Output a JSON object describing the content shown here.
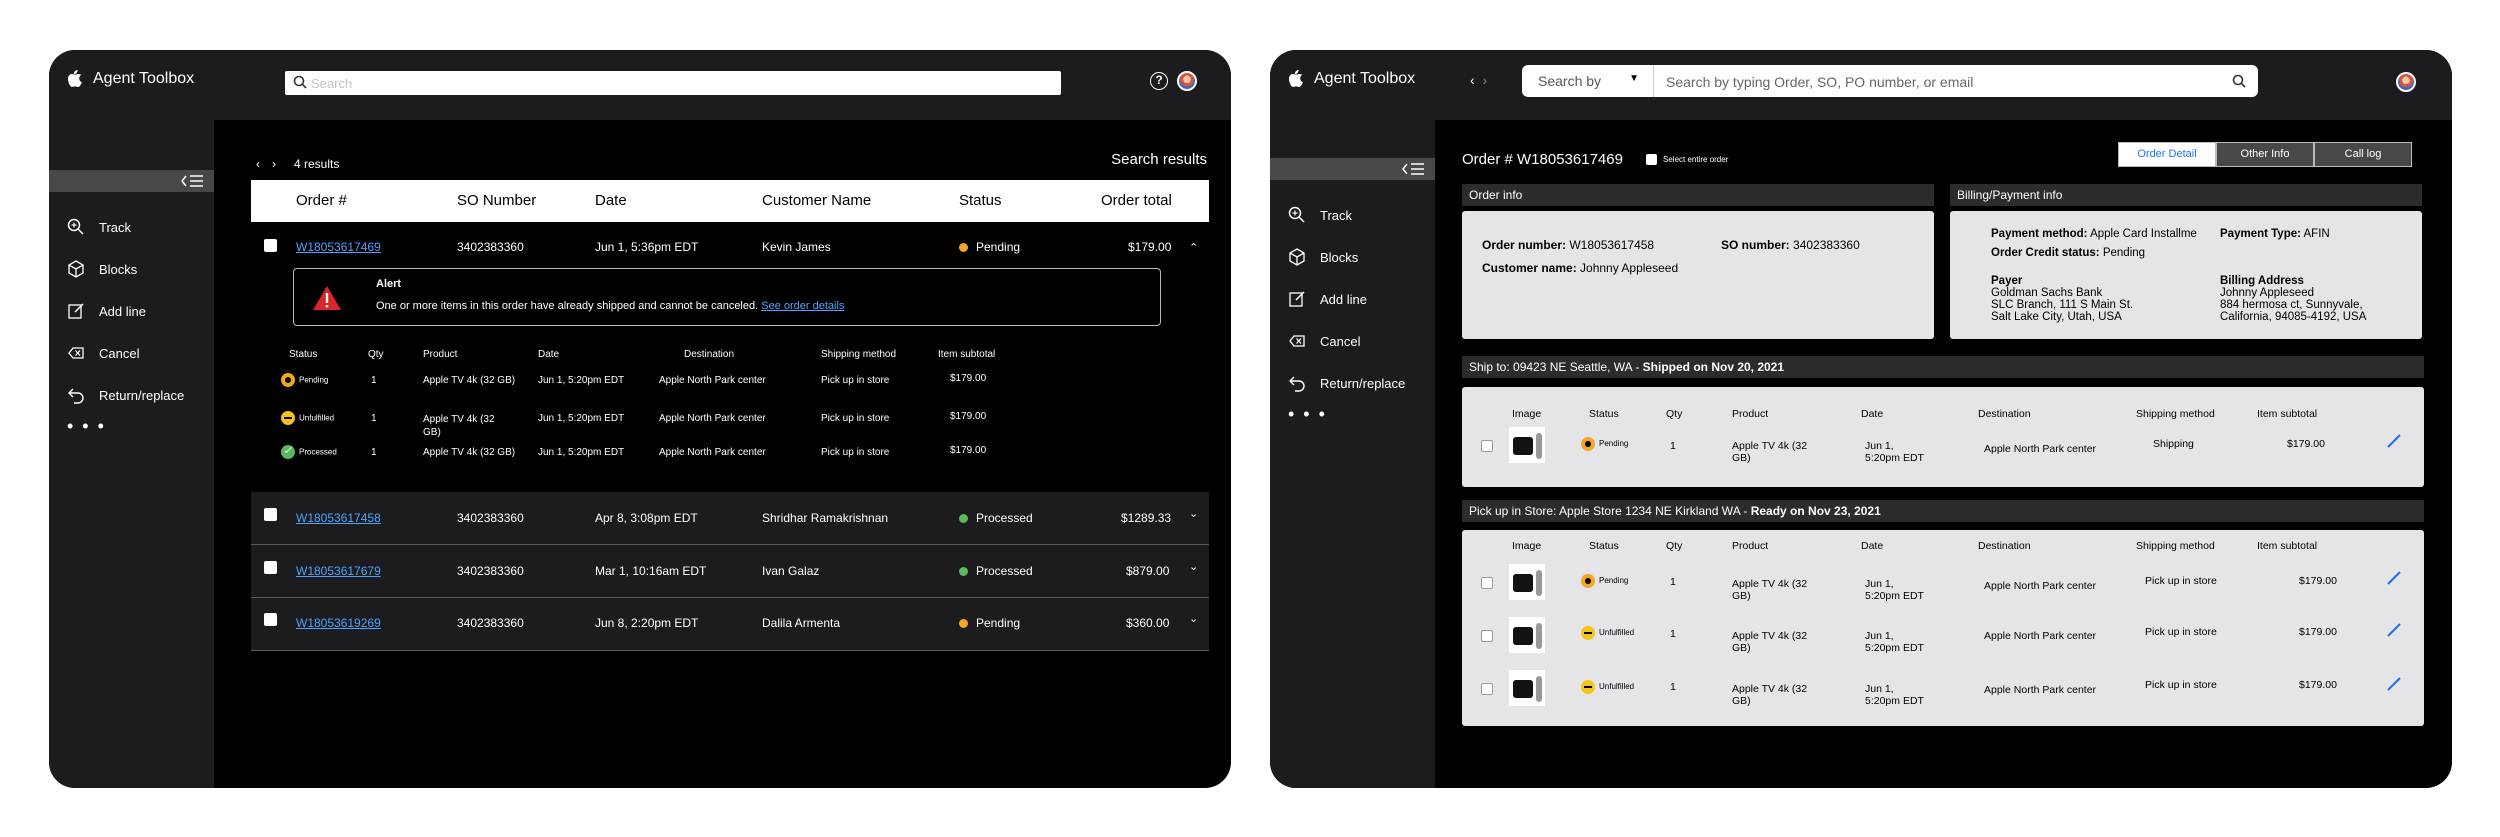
{
  "app": {
    "title": "Agent Toolbox"
  },
  "nav": {
    "items": [
      {
        "label": "Track",
        "icon": "search-magnify-icon"
      },
      {
        "label": "Blocks",
        "icon": "cube-icon"
      },
      {
        "label": "Add line",
        "icon": "edit-icon"
      },
      {
        "label": "Cancel",
        "icon": "cancel-icon"
      },
      {
        "label": "Return/replace",
        "icon": "return-icon"
      }
    ],
    "more": "• • •"
  },
  "screen1": {
    "search_placeholder": "Search",
    "help": "?",
    "result_count": "4 results",
    "results_title": "Search results",
    "columns": [
      "Order #",
      "SO Number",
      "Date",
      "Customer Name",
      "Status",
      "Order total"
    ],
    "orders": [
      {
        "order": "W18053617469",
        "so": "3402383360",
        "date": "Jun 1, 5:36pm EDT",
        "customer": "Kevin James",
        "status": "Pending",
        "total": "$179.00"
      },
      {
        "order": "W18053617458",
        "so": "3402383360",
        "date": "Apr 8, 3:08pm EDT",
        "customer": "Shridhar Ramakrishnan",
        "status": "Processed",
        "total": "$1289.33"
      },
      {
        "order": "W18053617679",
        "so": "3402383360",
        "date": "Mar 1, 10:16am EDT",
        "customer": "Ivan Galaz",
        "status": "Processed",
        "total": "$879.00"
      },
      {
        "order": "W18053619269",
        "so": "3402383360",
        "date": "Jun 8, 2:20pm EDT",
        "customer": "Dalila Armenta",
        "status": "Pending",
        "total": "$360.00"
      }
    ],
    "alert": {
      "title": "Alert",
      "message": "One or more items in this order have already shipped and cannot be canceled.",
      "link": "See order details"
    },
    "line_columns": [
      "Status",
      "Qty",
      "Product",
      "Date",
      "Destination",
      "Shipping method",
      "Item subtotal"
    ],
    "lines": [
      {
        "status": "Pending",
        "qty": "1",
        "product": "Apple TV 4k (32 GB)",
        "date": "Jun 1, 5:20pm EDT",
        "destination": "Apple North Park center",
        "shipping": "Pick up in store",
        "subtotal": "$179.00"
      },
      {
        "status": "Unfulfilled",
        "qty": "1",
        "product": "Apple TV 4k (32 GB)",
        "date": "Jun 1, 5:20pm EDT",
        "destination": "Apple North Park center",
        "shipping": "Pick up in store",
        "subtotal": "$179.00"
      },
      {
        "status": "Processed",
        "qty": "1",
        "product": "Apple TV 4k (32 GB)",
        "date": "Jun 1, 5:20pm EDT",
        "destination": "Apple North Park center",
        "shipping": "Pick up in store",
        "subtotal": "$179.00"
      }
    ]
  },
  "screen2": {
    "search_by": "Search by",
    "search_placeholder": "Search by typing Order, SO, PO number, or email",
    "order_heading": "Order # W18053617469",
    "select_entire": "Select entire order",
    "tabs": [
      "Order Detail",
      "Other Info",
      "Call log"
    ],
    "order_info": {
      "header": "Order info",
      "order_number_label": "Order number:",
      "order_number": "W18053617458",
      "so_label": "SO number:",
      "so": "3402383360",
      "customer_label": "Customer name:",
      "customer": "Johnny Appleseed"
    },
    "billing": {
      "header": "Billing/Payment info",
      "payment_method_label": "Payment method:",
      "payment_method": "Apple Card Installme",
      "payment_type_label": "Payment Type:",
      "payment_type": "AFIN",
      "credit_label": "Order Credit status:",
      "credit": "Pending",
      "payer_label": "Payer",
      "payer_lines": [
        "Goldman Sachs Bank",
        "SLC Branch, 111 S Main St.",
        "Salt Lake City, Utah, USA"
      ],
      "billing_label": "Billing Address",
      "billing_lines": [
        "Johnny Appleseed",
        "884 hermosa ct, Sunnyvale,",
        "California, 94085-4192, USA"
      ]
    },
    "ship_group": {
      "header": "Ship to: 09423 NE Seattle, WA  - ",
      "header_bold": "Shipped on Nov 20, 2021",
      "items": [
        {
          "status": "Pending",
          "qty": "1",
          "product": "Apple TV 4k (32 GB)",
          "date": "Jun 1, 5:20pm EDT",
          "destination": "Apple North Park center",
          "shipping": "Shipping",
          "subtotal": "$179.00"
        }
      ]
    },
    "pickup_group": {
      "header": "Pick up in Store: Apple Store 1234 NE Kirkland WA  - ",
      "header_bold": "Ready on Nov 23, 2021",
      "items": [
        {
          "status": "Pending",
          "qty": "1",
          "product": "Apple TV 4k (32 GB)",
          "date": "Jun 1, 5:20pm EDT",
          "destination": "Apple North Park center",
          "shipping": "Pick up in store",
          "subtotal": "$179.00"
        },
        {
          "status": "Unfulfilled",
          "qty": "1",
          "product": "Apple TV 4k (32 GB)",
          "date": "Jun 1, 5:20pm EDT",
          "destination": "Apple North Park center",
          "shipping": "Pick up in store",
          "subtotal": "$179.00"
        },
        {
          "status": "Unfulfilled",
          "qty": "1",
          "product": "Apple TV 4k (32 GB)",
          "date": "Jun 1, 5:20pm EDT",
          "destination": "Apple North Park center",
          "shipping": "Pick up in store",
          "subtotal": "$179.00"
        }
      ]
    },
    "item_columns": [
      "Image",
      "Status",
      "Qty",
      "Product",
      "Date",
      "Destination",
      "Shipping method",
      "Item subtotal"
    ]
  },
  "colors": {
    "pending": "#f5a623",
    "processed": "#5cb85c",
    "unfulfilled": "#f5c518",
    "link": "#4da3ff",
    "tab_active": "#1a73e8"
  }
}
